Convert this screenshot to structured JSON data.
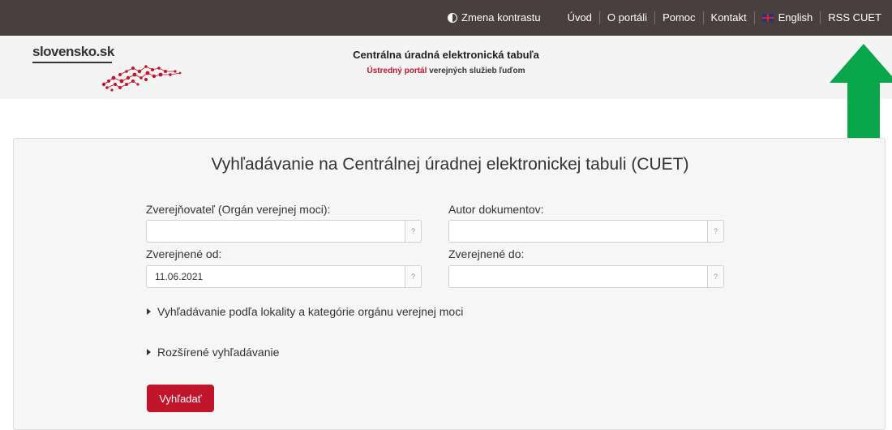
{
  "topnav": {
    "contrast": "Zmena kontrastu",
    "home": "Úvod",
    "about": "O portáli",
    "help": "Pomoc",
    "contact": "Kontakt",
    "english": "English",
    "rss": "RSS CUET"
  },
  "header": {
    "logo_text": "slovensko.sk",
    "title": "Centrálna úradná elektronická tabuľa",
    "subtitle_red": "Ústredný portál",
    "subtitle_rest": " verejných služieb ľuďom"
  },
  "search": {
    "heading": "Vyhľadávanie na Centrálnej úradnej elektronickej tabuli (CUET)",
    "publisher_label": "Zverejňovateľ (Orgán verejnej moci):",
    "publisher_value": "",
    "author_label": "Autor dokumentov:",
    "author_value": "",
    "from_label": "Zverejnené od:",
    "from_value": "11.06.2021",
    "to_label": "Zverejnené do:",
    "to_value": "",
    "help_mark": "?",
    "location_toggle": "Vyhľadávanie podľa lokality a kategórie orgánu verejnej moci",
    "advanced_toggle": "Rozšírené vyhľadávanie",
    "submit": "Vyhľadať"
  },
  "colors": {
    "topbar": "#4a3f3f",
    "accent_red": "#c0152b",
    "arrow_green": "#0aa64b"
  },
  "icons": {
    "contrast": "contrast-icon",
    "flag": "uk-flag-icon",
    "arrow": "green-up-arrow-icon",
    "toggle": "caret-right-icon"
  }
}
